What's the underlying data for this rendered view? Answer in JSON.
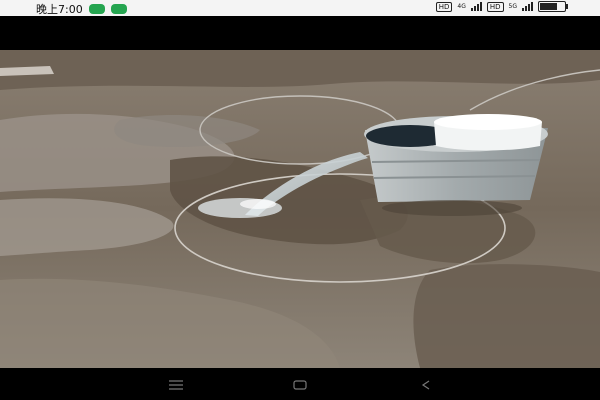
{
  "status_bar": {
    "time": "晚上7:00",
    "left_icons": [
      "wechat-icon",
      "phone-icon"
    ],
    "sim1_label": "HD",
    "sim2_label": "HD",
    "battery_level": 0.7
  },
  "media": {
    "icon": "image"
  },
  "nav_bar": {
    "buttons": [
      "menu-icon",
      "home-icon",
      "back-icon"
    ]
  },
  "colors": {
    "mud": "#7a6d5e",
    "water_pool": "#9b9289",
    "bucket": "#a9b0b2"
  }
}
